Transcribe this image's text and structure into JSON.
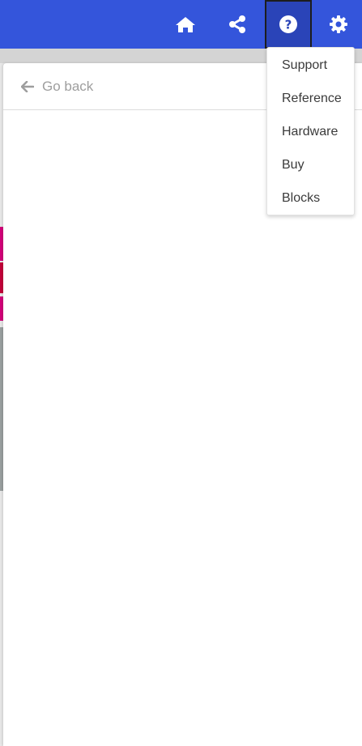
{
  "colors": {
    "topbar": "#3455db",
    "active_button": "#2a44b8",
    "panel": "#ffffff"
  },
  "topbar": {
    "icons": [
      "home-icon",
      "share-icon",
      "help-icon",
      "settings-icon"
    ]
  },
  "panel": {
    "go_back_label": "Go back"
  },
  "help_menu": {
    "items": [
      "Support",
      "Reference",
      "Hardware",
      "Buy",
      "Blocks"
    ]
  }
}
